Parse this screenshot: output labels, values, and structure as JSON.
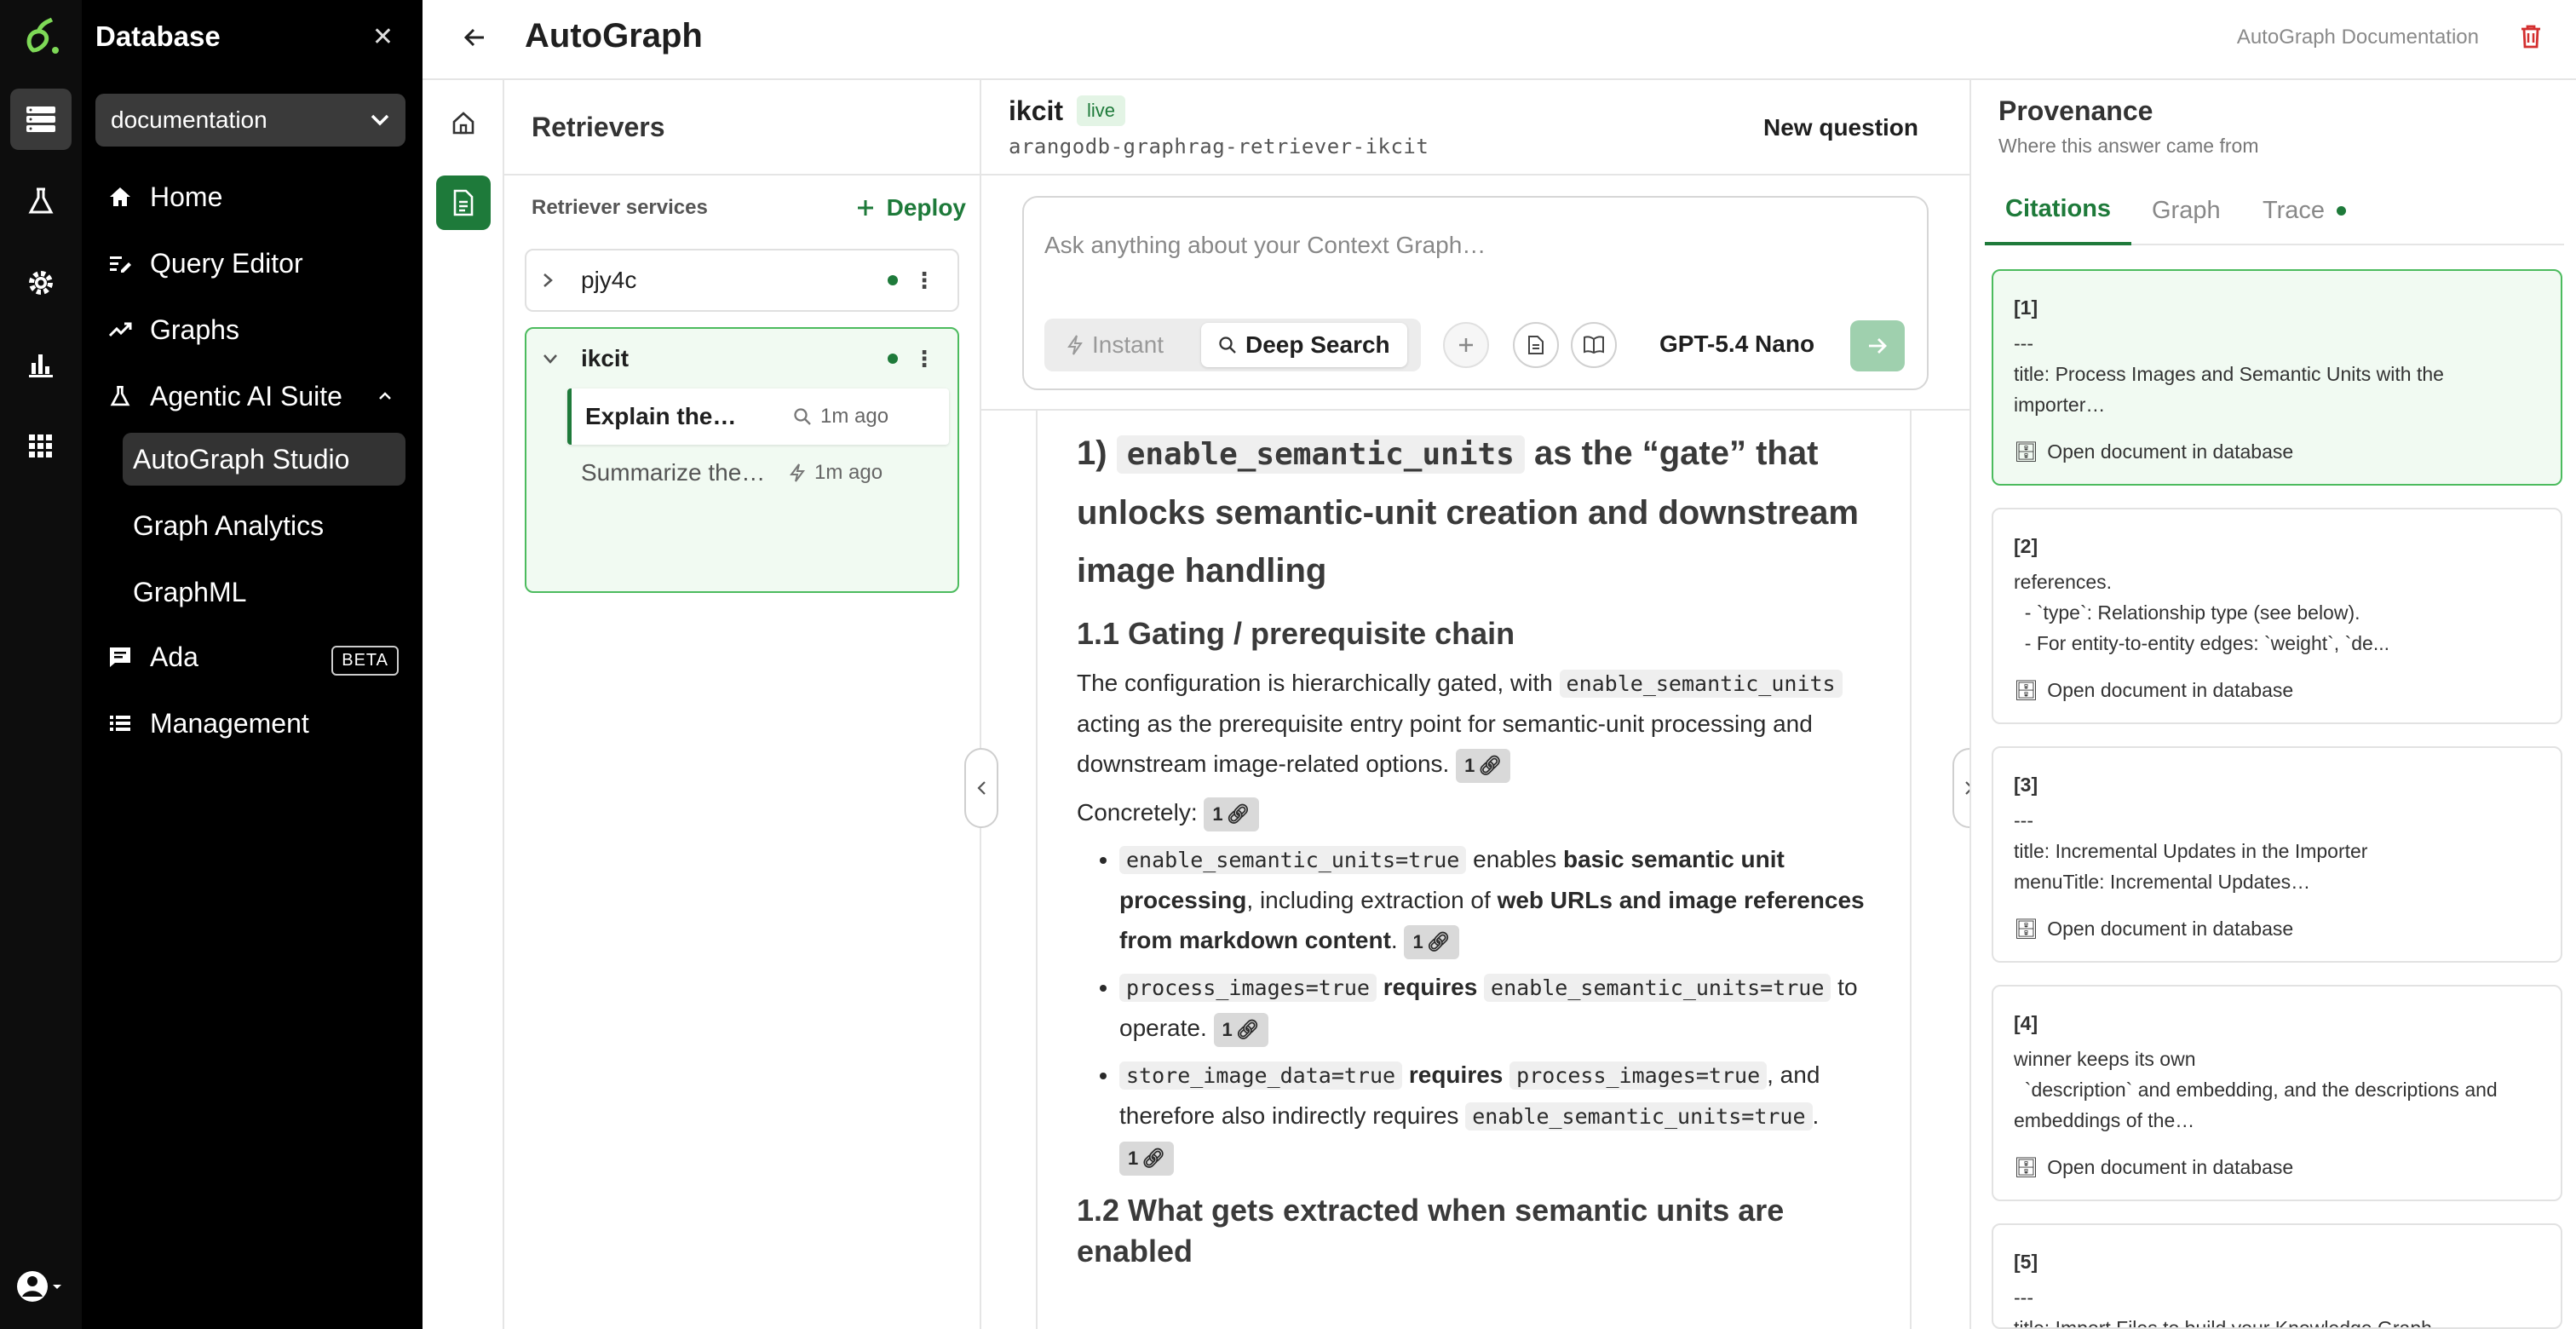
{
  "sidebar": {
    "title": "Database",
    "database_select": "documentation",
    "nav": {
      "home": "Home",
      "query_editor": "Query Editor",
      "graphs": "Graphs",
      "agentic": "Agentic AI Suite",
      "autograph_studio": "AutoGraph Studio",
      "graph_analytics": "Graph Analytics",
      "graphml": "GraphML",
      "ada": "Ada",
      "ada_badge": "BETA",
      "management": "Management"
    }
  },
  "header": {
    "title": "AutoGraph",
    "doc_link": "AutoGraph Documentation"
  },
  "retrievers": {
    "title": "Retrievers",
    "services_label": "Retriever services",
    "deploy_label": "Deploy",
    "services": [
      {
        "name": "pjy4c",
        "status": "online"
      },
      {
        "name": "ikcit",
        "status": "online",
        "threads": [
          {
            "title": "Explain the…",
            "mode": "deep-search",
            "time": "1m ago"
          },
          {
            "title": "Summarize the…",
            "mode": "instant",
            "time": "1m ago"
          }
        ]
      }
    ]
  },
  "chat": {
    "service_name": "ikcit",
    "status_badge": "live",
    "service_id": "arangodb-graphrag-retriever-ikcit",
    "new_question": "New question",
    "composer": {
      "placeholder": "Ask anything about your Context Graph…",
      "mode_instant": "Instant",
      "mode_deep": "Deep Search",
      "model": "GPT-5.4 Nano",
      "selected_mode": "Deep Search"
    },
    "answer": {
      "h1_num": "1)",
      "h1_code": "enable_semantic_units",
      "h1_rest": "as the “gate” that unlocks semantic-unit creation and downstream image handling",
      "h2a": "1.1 Gating / prerequisite chain",
      "p1_a": "The configuration is hierarchically gated, with",
      "p1_code": "enable_semantic_units",
      "p1_b": "acting as the prerequisite entry point for semantic-unit processing and downstream image-related options.",
      "p2": "Concretely:",
      "b1_code": "enable_semantic_units=true",
      "b1_a": "enables",
      "b1_bold1": "basic semantic unit processing",
      "b1_b": ", including extraction of",
      "b1_bold2": "web URLs and image references from markdown content",
      "b1_c": ".",
      "b2_code1": "process_images=true",
      "b2_bold": "requires",
      "b2_code2": "enable_semantic_units=true",
      "b2_a": "to operate.",
      "b3_code1": "store_image_data=true",
      "b3_bold": "requires",
      "b3_code2": "process_images=true",
      "b3_a": ", and therefore also indirectly requires",
      "b3_code3": "enable_semantic_units=true",
      "b3_b": ".",
      "h2b": "1.2 What gets extracted when semantic units are enabled",
      "cite": "1"
    }
  },
  "provenance": {
    "title": "Provenance",
    "subtitle": "Where this answer came from",
    "tabs": {
      "citations": "Citations",
      "graph": "Graph",
      "trace": "Trace"
    },
    "open_label": "Open document in database",
    "citations": [
      {
        "num": "[1]",
        "body": "---\ntitle: Process Images and Semantic Units with the\nimporter…"
      },
      {
        "num": "[2]",
        "body": "references.\n  - `type`: Relationship type (see below).\n  - For entity-to-entity edges: `weight`, `de..."
      },
      {
        "num": "[3]",
        "body": "---\ntitle: Incremental Updates in the Importer\nmenuTitle: Incremental Updates…"
      },
      {
        "num": "[4]",
        "body": "winner keeps its own\n  `description` and embedding, and the descriptions and\nembeddings of the…"
      },
      {
        "num": "[5]",
        "body": "---\ntitle: Import Files to build your Knowledge Graph"
      }
    ]
  },
  "colors": {
    "accent": "#1e7a3a",
    "accent_light": "#f1faf2",
    "sidebar_bg": "#000000",
    "danger": "#d32f2f"
  }
}
